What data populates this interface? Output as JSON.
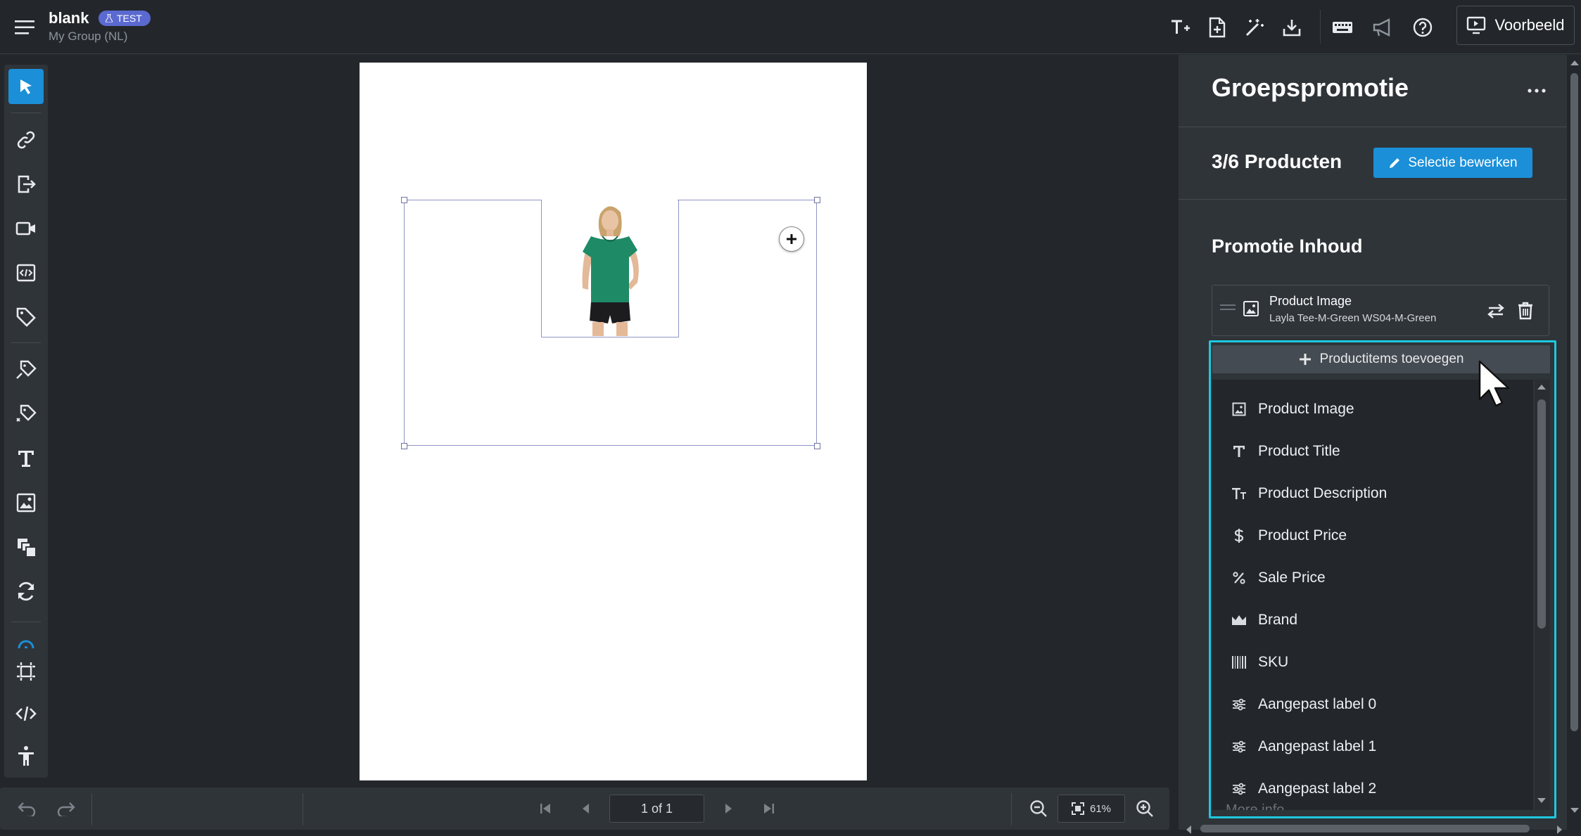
{
  "header": {
    "title": "blank",
    "badge": "TEST",
    "group": "My Group (NL)",
    "preview_label": "Voorbeeld",
    "icons": [
      "add-text-icon",
      "add-page-icon",
      "magic-wand-icon",
      "download-icon",
      "keyboard-icon",
      "megaphone-icon",
      "help-icon"
    ]
  },
  "left_toolbar": {
    "tools": [
      "select-icon",
      "link-icon",
      "export-icon",
      "video-icon",
      "code-embed-icon",
      "tag-icon",
      "product-tag-icon",
      "product-tag-edit-icon",
      "text-icon",
      "image-icon",
      "layers-icon",
      "refresh-icon",
      "gauge-icon",
      "frame-icon",
      "html-code-icon",
      "accessibility-icon"
    ]
  },
  "bottom_bar": {
    "page_indicator": "1 of 1",
    "zoom": "61%"
  },
  "panel": {
    "title": "Groepspromotie",
    "count": "3/6 Producten",
    "edit_selection": "Selectie bewerken",
    "content_heading": "Promotie Inhoud",
    "content_item": {
      "title": "Product Image",
      "subtitle": "Layla Tee-M-Green WS04-M-Green"
    },
    "add_items_label": "Productitems toevoegen",
    "dropdown_items": [
      {
        "label": "Product Image",
        "icon": "image-icon"
      },
      {
        "label": "Product Title",
        "icon": "title-icon"
      },
      {
        "label": "Product Description",
        "icon": "description-icon"
      },
      {
        "label": "Product Price",
        "icon": "dollar-icon"
      },
      {
        "label": "Sale Price",
        "icon": "percent-icon"
      },
      {
        "label": "Brand",
        "icon": "crown-icon"
      },
      {
        "label": "SKU",
        "icon": "barcode-icon"
      },
      {
        "label": "Aangepast label 0",
        "icon": "sliders-icon"
      },
      {
        "label": "Aangepast label 1",
        "icon": "sliders-icon"
      },
      {
        "label": "Aangepast label 2",
        "icon": "sliders-icon"
      }
    ],
    "dropdown_partial_item": "More info"
  },
  "colors": {
    "accent": "#1b8fd8",
    "highlight_outline": "#1cc9e0",
    "badge": "#5b6ad0",
    "tshirt": "#1f8a66"
  }
}
